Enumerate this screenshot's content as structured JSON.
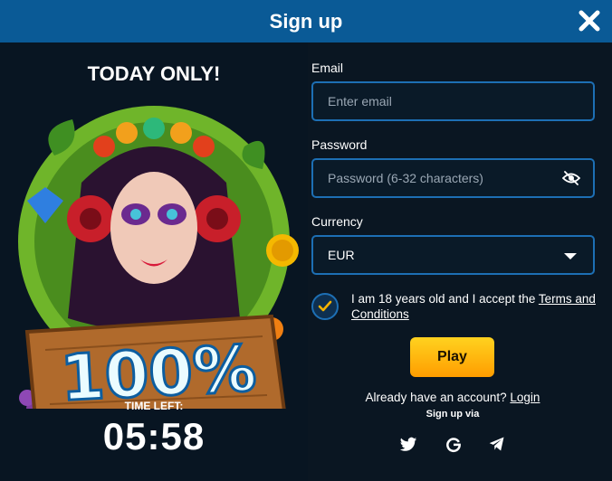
{
  "header": {
    "title": "Sign up"
  },
  "promo": {
    "title": "TODAY ONLY!",
    "bonus": "100%",
    "timer_label": "TIME LEFT:",
    "timer": "05:58"
  },
  "form": {
    "email_label": "Email",
    "email_placeholder": "Enter email",
    "password_label": "Password",
    "password_placeholder": "Password (6-32 characters)",
    "currency_label": "Currency",
    "currency_value": "EUR",
    "terms_prefix": "I am 18 years old and I accept the ",
    "terms_link": "Terms and Conditions",
    "age_checked": true,
    "play_label": "Play",
    "have_account": "Already have an account? ",
    "login_link": "Login",
    "signup_via": "Sign up via"
  },
  "social": [
    "twitter-icon",
    "google-icon",
    "telegram-icon"
  ],
  "colors": {
    "header": "#0a5a96",
    "field_border": "#1d6fb4",
    "play_top": "#ffd21f",
    "play_bottom": "#ff9d00",
    "check": "#f5b300"
  }
}
